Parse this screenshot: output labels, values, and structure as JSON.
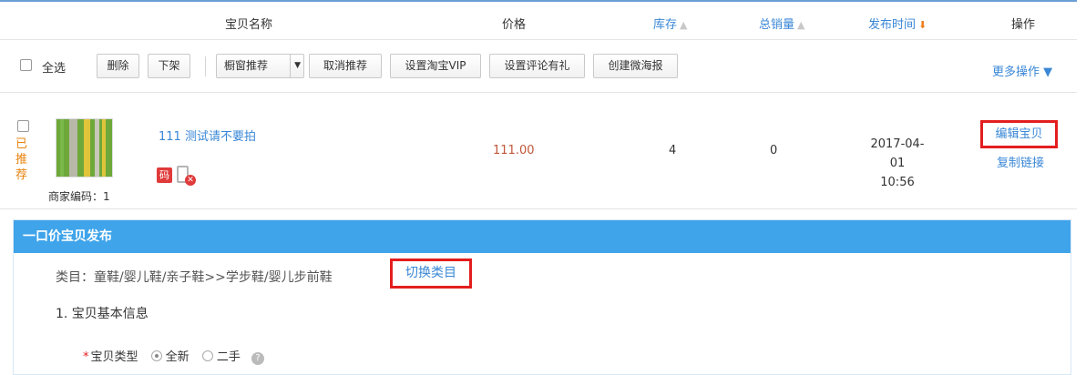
{
  "header": {
    "name_col": "宝贝名称",
    "price_col": "价格",
    "stock_col": "库存",
    "sales_col": "总销量",
    "time_col": "发布时间",
    "ops_col": "操作"
  },
  "toolbar": {
    "select_all": "全选",
    "delete": "删除",
    "delist": "下架",
    "window_recommend": "橱窗推荐",
    "cancel_recommend": "取消推荐",
    "set_vip": "设置淘宝VIP",
    "set_review_gift": "设置评论有礼",
    "create_poster": "创建微海报",
    "more_ops": "更多操作 ▼"
  },
  "product": {
    "recommended_tag": "已推荐",
    "title": "111 测试请不要拍",
    "merchant_code": "商家编码：1",
    "code_badge": "码",
    "price": "111.00",
    "stock": "4",
    "sales": "0",
    "date": "2017-04-01",
    "time": "10:56",
    "edit": "编辑宝贝",
    "copy_link": "复制链接"
  },
  "publish": {
    "title": "一口价宝贝发布",
    "category": "类目：童鞋/婴儿鞋/亲子鞋>>学步鞋/婴儿步前鞋",
    "switch_category": "切换类目",
    "section_title": "1. 宝贝基本信息",
    "type_label": "宝贝类型",
    "type_new": "全新",
    "type_used": "二手",
    "type_selected": "全新"
  },
  "colors": {
    "link": "#3a87d6",
    "panel_header": "#3fa4ea",
    "highlight_box": "#e31e1e",
    "price": "#c0573a",
    "sort_active": "#f07d1a"
  }
}
